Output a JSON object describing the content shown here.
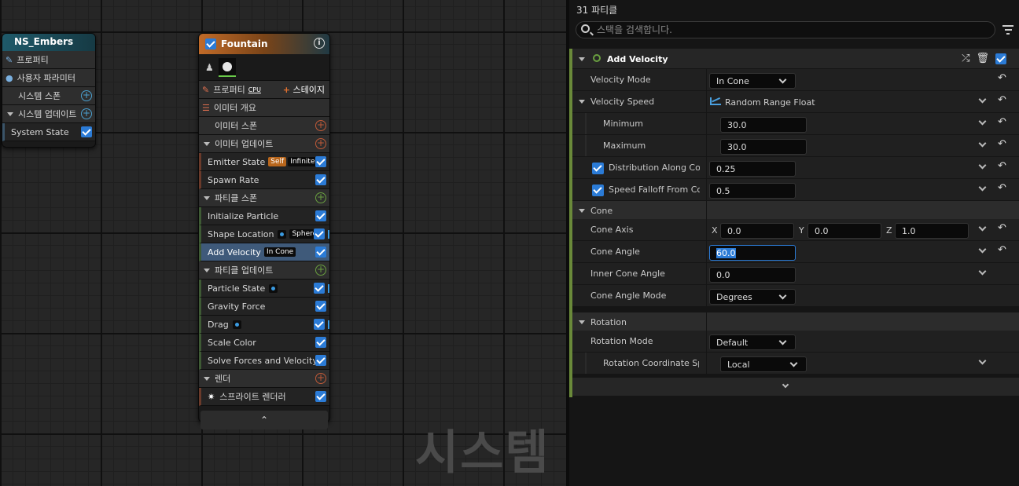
{
  "ns_node": {
    "title": "NS_Embers",
    "rows": [
      "프로퍼티",
      "사용자 파라미터",
      "시스템 스폰",
      "시스템 업데이트",
      "System State"
    ]
  },
  "fountain": {
    "title": "Fountain",
    "properties_label": "프로퍼티",
    "cpu_label": "CPU",
    "stage_label": "스테이지",
    "emitter_summary": "이미터 개요",
    "emitter_spawn": "이미터 스폰",
    "emitter_update": "이미터 업데이트",
    "emitter_state": "Emitter State",
    "self_tag": "Self",
    "infinite_tag": "Infinite",
    "spawn_rate": "Spawn Rate",
    "particle_spawn": "파티클 스폰",
    "initialize_particle": "Initialize Particle",
    "shape_location": "Shape Location",
    "sphere_tag": "Sphere",
    "add_velocity": "Add Velocity",
    "in_cone_tag": "In Cone",
    "particle_update": "파티클 업데이트",
    "particle_state": "Particle State",
    "gravity_force": "Gravity Force",
    "drag": "Drag",
    "scale_color": "Scale Color",
    "solve_forces": "Solve Forces and Velocity",
    "render": "렌더",
    "sprite_renderer": "스프라이트 렌더러"
  },
  "watermark": "시스템",
  "panel": {
    "title": "31 파티클",
    "search_placeholder": "스택을 검색합니다.",
    "module_title": "Add Velocity",
    "velocity_mode_label": "Velocity Mode",
    "velocity_mode_value": "In Cone",
    "velocity_speed_label": "Velocity Speed",
    "velocity_speed_value": "Random Range Float",
    "minimum_label": "Minimum",
    "minimum_value": "30.0",
    "maximum_label": "Maximum",
    "maximum_value": "30.0",
    "distribution_label": "Distribution Along Cone",
    "distribution_value": "0.25",
    "falloff_label": "Speed Falloff From Cone",
    "falloff_value": "0.5",
    "cone_category": "Cone",
    "cone_axis_label": "Cone Axis",
    "x_label": "X",
    "x_value": "0.0",
    "y_label": "Y",
    "y_value": "0.0",
    "z_label": "Z",
    "z_value": "1.0",
    "cone_angle_label": "Cone Angle",
    "cone_angle_value": "60.0",
    "inner_cone_label": "Inner Cone Angle",
    "inner_cone_value": "0.0",
    "cone_mode_label": "Cone Angle Mode",
    "cone_mode_value": "Degrees",
    "rotation_category": "Rotation",
    "rotation_mode_label": "Rotation Mode",
    "rotation_mode_value": "Default",
    "rotation_space_label": "Rotation Coordinate Space",
    "rotation_space_value": "Local"
  }
}
